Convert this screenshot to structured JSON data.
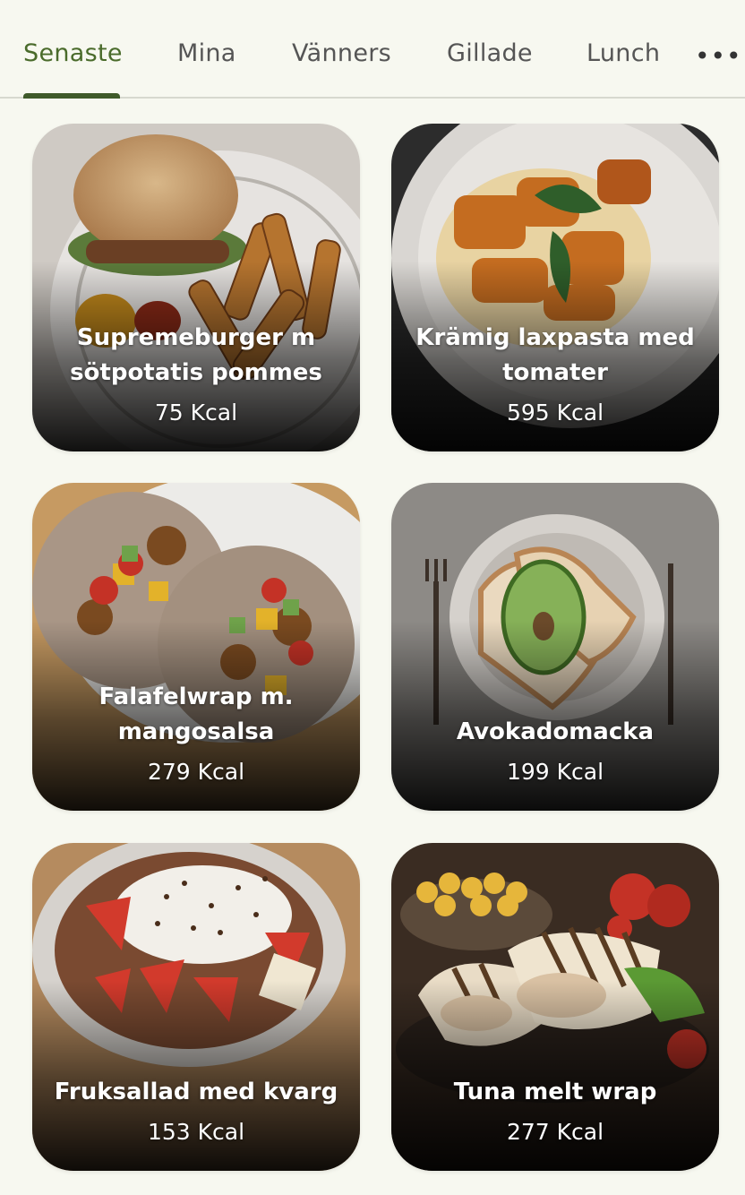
{
  "tabs": {
    "items": [
      "Senaste",
      "Mina",
      "Vänners",
      "Gillade",
      "Lunch"
    ],
    "active": "Senaste",
    "more_label": "•••"
  },
  "recipes": [
    {
      "title": "Supremeburger m sötpotatis pommes",
      "kcal": "75 Kcal"
    },
    {
      "title": "Krämig laxpasta med tomater",
      "kcal": "595 Kcal"
    },
    {
      "title": "Falafelwrap m. mangosalsa",
      "kcal": "279 Kcal"
    },
    {
      "title": "Avokadomacka",
      "kcal": "199 Kcal"
    },
    {
      "title": "Fruksallad med kvarg",
      "kcal": "153 Kcal"
    },
    {
      "title": "Tuna melt wrap",
      "kcal": "277 Kcal"
    }
  ],
  "colors": {
    "accent": "#4a6b2b",
    "background": "#f7f8f0"
  }
}
